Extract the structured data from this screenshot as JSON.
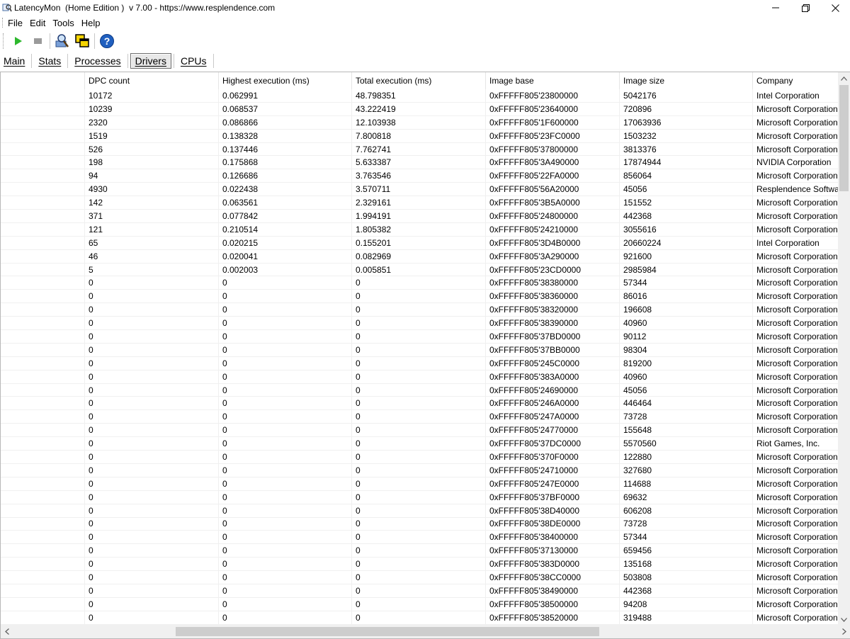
{
  "window": {
    "title": "LatencyMon  (Home Edition )  v 7.00 - https://www.resplendence.com",
    "controls": [
      "minimize-icon",
      "maximize-icon",
      "close-icon"
    ]
  },
  "menu": [
    "File",
    "Edit",
    "Tools",
    "Help"
  ],
  "toolbar": {
    "buttons": [
      "play-icon",
      "stop-icon",
      "search-driver-icon",
      "copy-windows-icon",
      "help-icon"
    ]
  },
  "tabs": [
    "Main",
    "Stats",
    "Processes",
    "Drivers",
    "CPUs"
  ],
  "active_tab": "Drivers",
  "table": {
    "columns": [
      "",
      "DPC count",
      "Highest execution (ms)",
      "Total execution (ms)",
      "Image base",
      "Image size",
      "Company"
    ],
    "rows": [
      [
        "",
        "10172",
        "0.062991",
        "48.798351",
        "0xFFFFF805'23800000",
        "5042176",
        "Intel Corporation"
      ],
      [
        "",
        "10239",
        "0.068537",
        "43.222419",
        "0xFFFFF805'23640000",
        "720896",
        "Microsoft Corporation"
      ],
      [
        "",
        "2320",
        "0.086866",
        "12.103938",
        "0xFFFFF805'1F600000",
        "17063936",
        "Microsoft Corporation"
      ],
      [
        "",
        "1519",
        "0.138328",
        "7.800818",
        "0xFFFFF805'23FC0000",
        "1503232",
        "Microsoft Corporation"
      ],
      [
        "",
        "526",
        "0.137446",
        "7.762741",
        "0xFFFFF805'37800000",
        "3813376",
        "Microsoft Corporation"
      ],
      [
        "",
        "198",
        "0.175868",
        "5.633387",
        "0xFFFFF805'3A490000",
        "17874944",
        "NVIDIA Corporation"
      ],
      [
        "",
        "94",
        "0.126686",
        "3.763546",
        "0xFFFFF805'22FA0000",
        "856064",
        "Microsoft Corporation"
      ],
      [
        "",
        "4930",
        "0.022438",
        "3.570711",
        "0xFFFFF805'56A20000",
        "45056",
        "Resplendence Software"
      ],
      [
        "",
        "142",
        "0.063561",
        "2.329161",
        "0xFFFFF805'3B5A0000",
        "151552",
        "Microsoft Corporation"
      ],
      [
        "",
        "371",
        "0.077842",
        "1.994191",
        "0xFFFFF805'24800000",
        "442368",
        "Microsoft Corporation"
      ],
      [
        "",
        "121",
        "0.210514",
        "1.805382",
        "0xFFFFF805'24210000",
        "3055616",
        "Microsoft Corporation"
      ],
      [
        "",
        "65",
        "0.020215",
        "0.155201",
        "0xFFFFF805'3D4B0000",
        "20660224",
        "Intel Corporation"
      ],
      [
        "",
        "46",
        "0.020041",
        "0.082969",
        "0xFFFFF805'3A290000",
        "921600",
        "Microsoft Corporation"
      ],
      [
        "",
        "5",
        "0.002003",
        "0.005851",
        "0xFFFFF805'23CD0000",
        "2985984",
        "Microsoft Corporation"
      ],
      [
        "",
        "0",
        "0",
        "0",
        "0xFFFFF805'38380000",
        "57344",
        "Microsoft Corporation"
      ],
      [
        "",
        "0",
        "0",
        "0",
        "0xFFFFF805'38360000",
        "86016",
        "Microsoft Corporation"
      ],
      [
        "",
        "0",
        "0",
        "0",
        "0xFFFFF805'38320000",
        "196608",
        "Microsoft Corporation"
      ],
      [
        "",
        "0",
        "0",
        "0",
        "0xFFFFF805'38390000",
        "40960",
        "Microsoft Corporation"
      ],
      [
        "",
        "0",
        "0",
        "0",
        "0xFFFFF805'37BD0000",
        "90112",
        "Microsoft Corporation"
      ],
      [
        "",
        "0",
        "0",
        "0",
        "0xFFFFF805'37BB0000",
        "98304",
        "Microsoft Corporation"
      ],
      [
        "",
        "0",
        "0",
        "0",
        "0xFFFFF805'245C0000",
        "819200",
        "Microsoft Corporation"
      ],
      [
        "",
        "0",
        "0",
        "0",
        "0xFFFFF805'383A0000",
        "40960",
        "Microsoft Corporation"
      ],
      [
        "",
        "0",
        "0",
        "0",
        "0xFFFFF805'24690000",
        "45056",
        "Microsoft Corporation"
      ],
      [
        "",
        "0",
        "0",
        "0",
        "0xFFFFF805'246A0000",
        "446464",
        "Microsoft Corporation"
      ],
      [
        "",
        "0",
        "0",
        "0",
        "0xFFFFF805'247A0000",
        "73728",
        "Microsoft Corporation"
      ],
      [
        "",
        "0",
        "0",
        "0",
        "0xFFFFF805'24770000",
        "155648",
        "Microsoft Corporation"
      ],
      [
        "",
        "0",
        "0",
        "0",
        "0xFFFFF805'37DC0000",
        "5570560",
        "Riot Games, Inc."
      ],
      [
        "",
        "0",
        "0",
        "0",
        "0xFFFFF805'370F0000",
        "122880",
        "Microsoft Corporation"
      ],
      [
        "",
        "0",
        "0",
        "0",
        "0xFFFFF805'24710000",
        "327680",
        "Microsoft Corporation"
      ],
      [
        "",
        "0",
        "0",
        "0",
        "0xFFFFF805'247E0000",
        "114688",
        "Microsoft Corporation"
      ],
      [
        "",
        "0",
        "0",
        "0",
        "0xFFFFF805'37BF0000",
        "69632",
        "Microsoft Corporation"
      ],
      [
        "",
        "0",
        "0",
        "0",
        "0xFFFFF805'38D40000",
        "606208",
        "Microsoft Corporation"
      ],
      [
        "",
        "0",
        "0",
        "0",
        "0xFFFFF805'38DE0000",
        "73728",
        "Microsoft Corporation"
      ],
      [
        "",
        "0",
        "0",
        "0",
        "0xFFFFF805'38400000",
        "57344",
        "Microsoft Corporation"
      ],
      [
        "",
        "0",
        "0",
        "0",
        "0xFFFFF805'37130000",
        "659456",
        "Microsoft Corporation"
      ],
      [
        "",
        "0",
        "0",
        "0",
        "0xFFFFF805'383D0000",
        "135168",
        "Microsoft Corporation"
      ],
      [
        "",
        "0",
        "0",
        "0",
        "0xFFFFF805'38CC0000",
        "503808",
        "Microsoft Corporation"
      ],
      [
        "",
        "0",
        "0",
        "0",
        "0xFFFFF805'38490000",
        "442368",
        "Microsoft Corporation"
      ],
      [
        "",
        "0",
        "0",
        "0",
        "0xFFFFF805'38500000",
        "94208",
        "Microsoft Corporation"
      ],
      [
        "",
        "0",
        "0",
        "0",
        "0xFFFFF805'38520000",
        "319488",
        "Microsoft Corporation"
      ]
    ]
  },
  "scrollbars": {
    "vertical": [
      "scroll-up-icon",
      "scroll-down-icon"
    ],
    "horizontal": [
      "scroll-left-icon",
      "scroll-right-icon"
    ]
  },
  "colors": {
    "play": "#2db82d",
    "stop": "#9a9a9a",
    "help": "#1f5fbf",
    "scroll_thumb": "#cdcdcd",
    "scroll_track": "#f0f0f0"
  }
}
